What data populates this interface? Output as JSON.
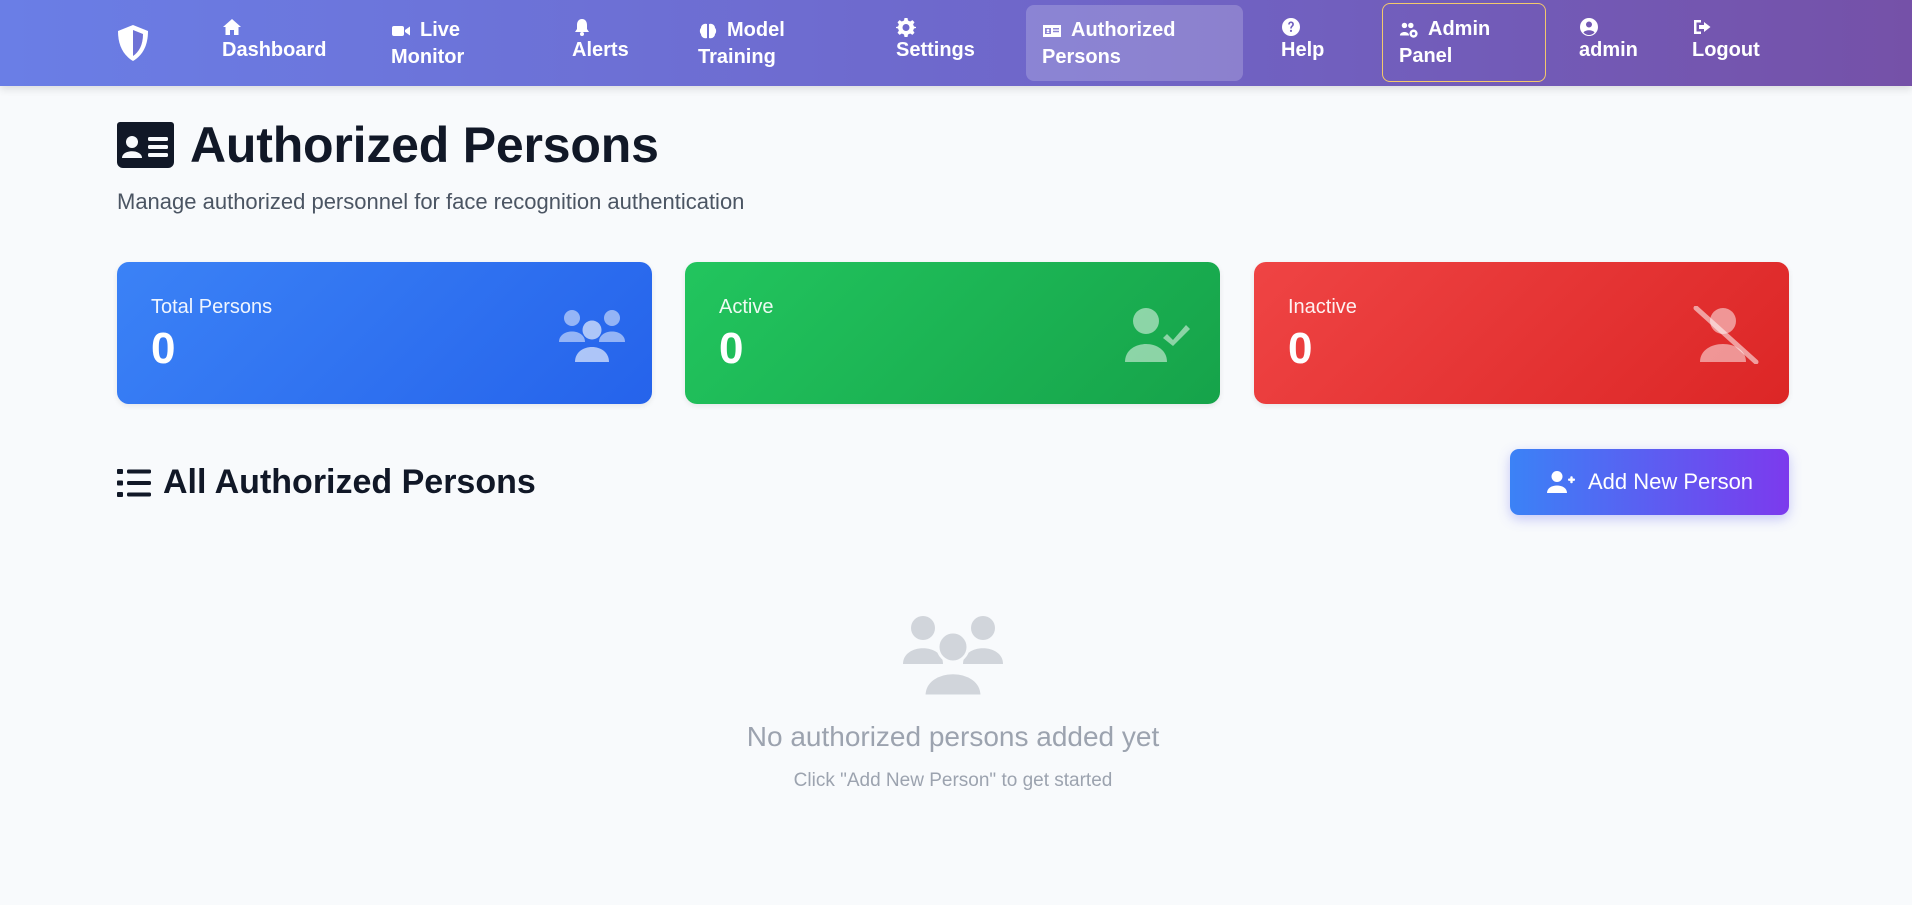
{
  "nav": {
    "items": [
      {
        "line1": "Dashboard",
        "line2": "",
        "icon": "home-icon"
      },
      {
        "line1": "Live",
        "line2": "Monitor",
        "icon": "video-camera-icon"
      },
      {
        "line1": "",
        "line2": "Alerts",
        "icon": "bell-icon"
      },
      {
        "line1": "Model",
        "line2": "Training",
        "icon": "brain-icon"
      },
      {
        "line1": "",
        "line2": "Settings",
        "icon": "gear-icon"
      },
      {
        "line1": "Authorized",
        "line2": "Persons",
        "icon": "id-card-icon"
      },
      {
        "line1": "",
        "line2": "Help",
        "icon": "question-circle-icon"
      },
      {
        "line1": "Admin",
        "line2": "Panel",
        "icon": "users-gear-icon"
      },
      {
        "line1": "",
        "line2": "admin",
        "icon": "user-circle-icon"
      },
      {
        "line1": "",
        "line2": "Logout",
        "icon": "sign-out-icon"
      }
    ],
    "active_item": "Authorized Persons"
  },
  "header": {
    "title": "Authorized Persons",
    "subtitle": "Manage authorized personnel for face recognition authentication"
  },
  "stats": [
    {
      "label": "Total Persons",
      "value": "0",
      "color": "#3b82f6",
      "icon": "users-icon"
    },
    {
      "label": "Active",
      "value": "0",
      "color": "#22c55e",
      "icon": "user-check-icon"
    },
    {
      "label": "Inactive",
      "value": "0",
      "color": "#ef4444",
      "icon": "user-slash-icon"
    }
  ],
  "section": {
    "title": "All Authorized Persons",
    "add_button_label": "Add New Person"
  },
  "empty_state": {
    "title": "No authorized persons added yet",
    "hint": "Click \"Add New Person\" to get started"
  },
  "colors": {
    "nav_gradient_start": "#6a7ee6",
    "nav_gradient_end": "#7551a8",
    "admin_border": "#f3c96b",
    "button_gradient_start": "#3b82f6",
    "button_gradient_end": "#7c3aed"
  }
}
